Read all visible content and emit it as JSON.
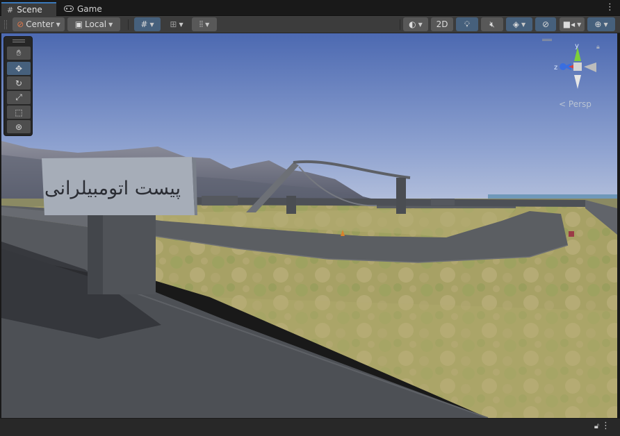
{
  "tabs": [
    {
      "label": "Scene",
      "icon": "grid-icon",
      "active": true
    },
    {
      "label": "Game",
      "icon": "gamepad-icon",
      "active": false
    }
  ],
  "toolbar": {
    "pivot_label": "Center",
    "space_label": "Local",
    "mode_2d_label": "2D"
  },
  "gizmo": {
    "y_label": "y",
    "z_label": "z",
    "projection_label": "Persp"
  },
  "sign": {
    "text": "پیست اتومبیلرانی"
  },
  "colors": {
    "accent": "#3a79bb",
    "toolbar_bg": "#3c3c3c",
    "button_active": "#46607c",
    "sky_top": "#4f6eb7",
    "sky_horizon": "#c6cfe3",
    "grass": "#a9a064",
    "road": "#5b5e62"
  }
}
